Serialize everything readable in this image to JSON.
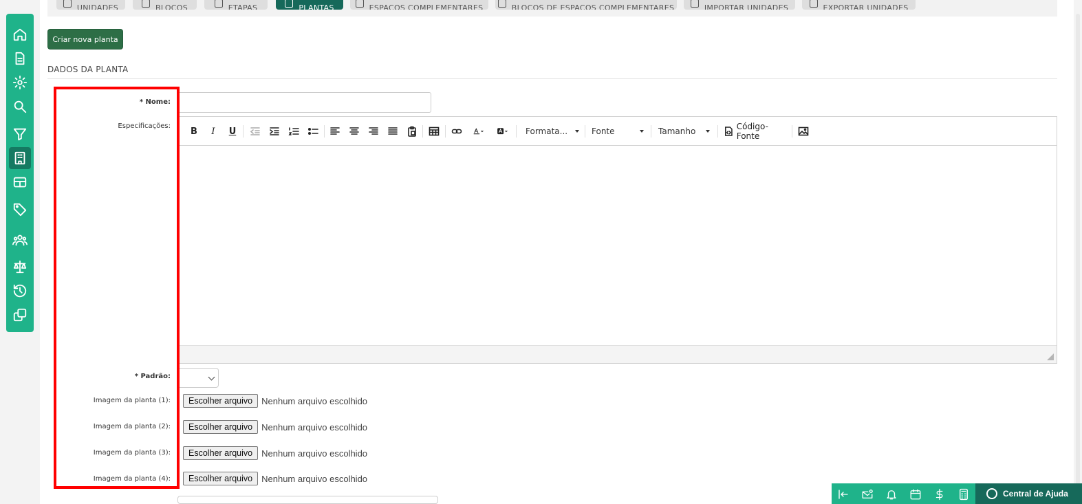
{
  "tabs": [
    {
      "label": "UNIDADES",
      "active": false
    },
    {
      "label": "BLOCOS",
      "active": false
    },
    {
      "label": "ETAPAS",
      "active": false
    },
    {
      "label": "PLANTAS",
      "active": true
    },
    {
      "label": "ESPAÇOS COMPLEMENTARES",
      "active": false
    },
    {
      "label": "BLOCOS DE ESPAÇOS COMPLEMENTARES",
      "active": false
    },
    {
      "label": "IMPORTAR UNIDADES",
      "active": false
    },
    {
      "label": "EXPORTAR UNIDADES",
      "active": false
    }
  ],
  "actions": {
    "create_label": "Criar nova planta"
  },
  "section": {
    "title": "DADOS DA PLANTA"
  },
  "form": {
    "name_label": "* Nome:",
    "name_value": "",
    "specs_label": "Especificações:",
    "padrao_label": "* Padrão:",
    "padrao_value": "",
    "image_labels": [
      "Imagem da planta (1):",
      "Imagem da planta (2):",
      "Imagem da planta (3):",
      "Imagem da planta (4):"
    ],
    "file_button": "Escolher arquivo",
    "file_status": "Nenhum arquivo escolhido"
  },
  "editor": {
    "format_label": "Formata...",
    "font_label": "Fonte",
    "size_label": "Tamanho",
    "source_label": "Código-Fonte",
    "bold_glyph": "B",
    "italic_glyph": "I",
    "underline_glyph": "U"
  },
  "sidebar_icons": [
    "home-icon",
    "document-icon",
    "gear-icon",
    "search-icon",
    "filter-icon",
    "building-icon",
    "table-icon",
    "tag-icon",
    "users-icon",
    "scale-icon",
    "history-icon",
    "copy-icon"
  ],
  "footer": {
    "help_label": "Central de Ajuda",
    "icons": [
      "collapse-left-icon",
      "mail-settings-icon",
      "bell-icon",
      "calendar-icon",
      "dollar-icon",
      "calculator-icon"
    ]
  },
  "colors": {
    "sidebar": "#1fb38a",
    "active_tab": "#16695a",
    "primary_button": "#2d6e46",
    "highlight": "#ff0000"
  }
}
